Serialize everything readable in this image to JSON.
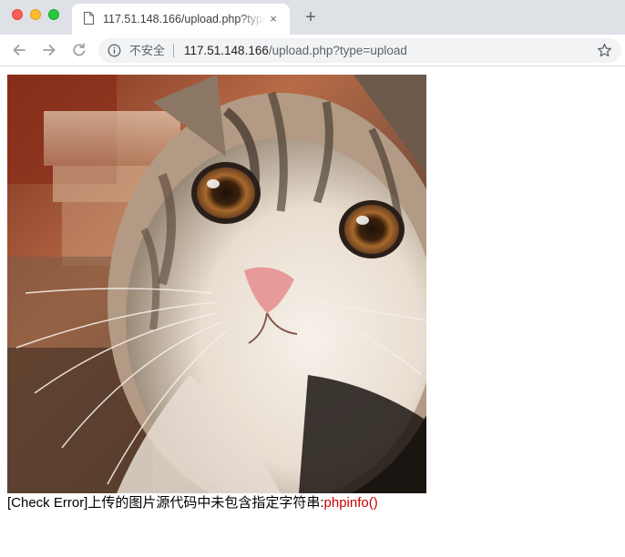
{
  "window": {
    "controls": [
      "close",
      "minimize",
      "zoom"
    ]
  },
  "tab": {
    "title": "117.51.148.166/upload.php?type=upload",
    "favicon": "document-icon",
    "close_icon": "×"
  },
  "new_tab_icon": "+",
  "toolbar": {
    "back_icon": "back-arrow-icon",
    "forward_icon": "forward-arrow-icon",
    "reload_icon": "reload-icon",
    "security_label": "不安全",
    "url_host": "117.51.148.166",
    "url_path": "/upload.php?type=upload",
    "bookmark_icon": "star-icon"
  },
  "page": {
    "image": "cat photo",
    "message_prefix": "[Check Error]上传的图片源代码中未包含指定字符串:",
    "message_highlight": "phpinfo()",
    "highlight_color": "#cc0000"
  }
}
